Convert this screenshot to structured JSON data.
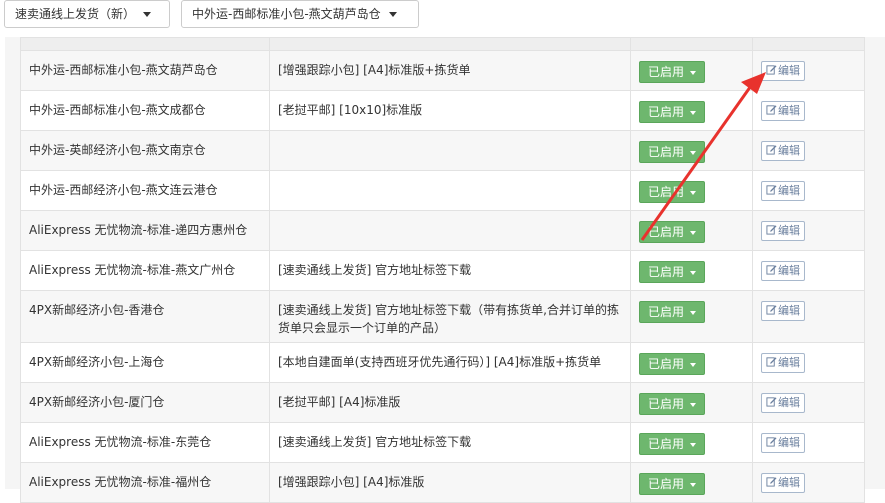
{
  "filters": {
    "channel_selected": "速卖通线上发货（新）",
    "warehouse_selected": "中外运-西邮标准小包-燕文葫芦岛仓"
  },
  "colors": {
    "enabled_button": "#6eb76e",
    "annotation_arrow": "#e8322d"
  },
  "rows": [
    {
      "name": "中外运-西邮标准小包-燕文葫芦岛仓",
      "template": "[增强跟踪小包] [A4]标准版+拣货单",
      "status": "已启用",
      "action": "编辑"
    },
    {
      "name": "中外运-西邮标准小包-燕文成都仓",
      "template": "[老挝平邮] [10x10]标准版",
      "status": "已启用",
      "action": "编辑"
    },
    {
      "name": "中外运-英邮经济小包-燕文南京仓",
      "template": "",
      "status": "已启用",
      "action": "编辑"
    },
    {
      "name": "中外运-西邮经济小包-燕文连云港仓",
      "template": "",
      "status": "已启用",
      "action": "编辑"
    },
    {
      "name": "AliExpress 无忧物流-标准-递四方惠州仓",
      "template": "",
      "status": "已启用",
      "action": "编辑"
    },
    {
      "name": "AliExpress 无忧物流-标准-燕文广州仓",
      "template": "[速卖通线上发货] 官方地址标签下载",
      "status": "已启用",
      "action": "编辑"
    },
    {
      "name": "4PX新邮经济小包-香港仓",
      "template": "[速卖通线上发货] 官方地址标签下载（带有拣货单,合并订单的拣货单只会显示一个订单的产品）",
      "status": "已启用",
      "action": "编辑"
    },
    {
      "name": "4PX新邮经济小包-上海仓",
      "template": "[本地自建面单(支持西班牙优先通行码）] [A4]标准版+拣货单",
      "status": "已启用",
      "action": "编辑"
    },
    {
      "name": "4PX新邮经济小包-厦门仓",
      "template": "[老挝平邮] [A4]标准版",
      "status": "已启用",
      "action": "编辑"
    },
    {
      "name": "AliExpress 无忧物流-标准-东莞仓",
      "template": "[速卖通线上发货] 官方地址标签下载",
      "status": "已启用",
      "action": "编辑"
    },
    {
      "name": "AliExpress 无忧物流-标准-福州仓",
      "template": "[增强跟踪小包] [A4]标准版",
      "status": "已启用",
      "action": "编辑"
    }
  ]
}
